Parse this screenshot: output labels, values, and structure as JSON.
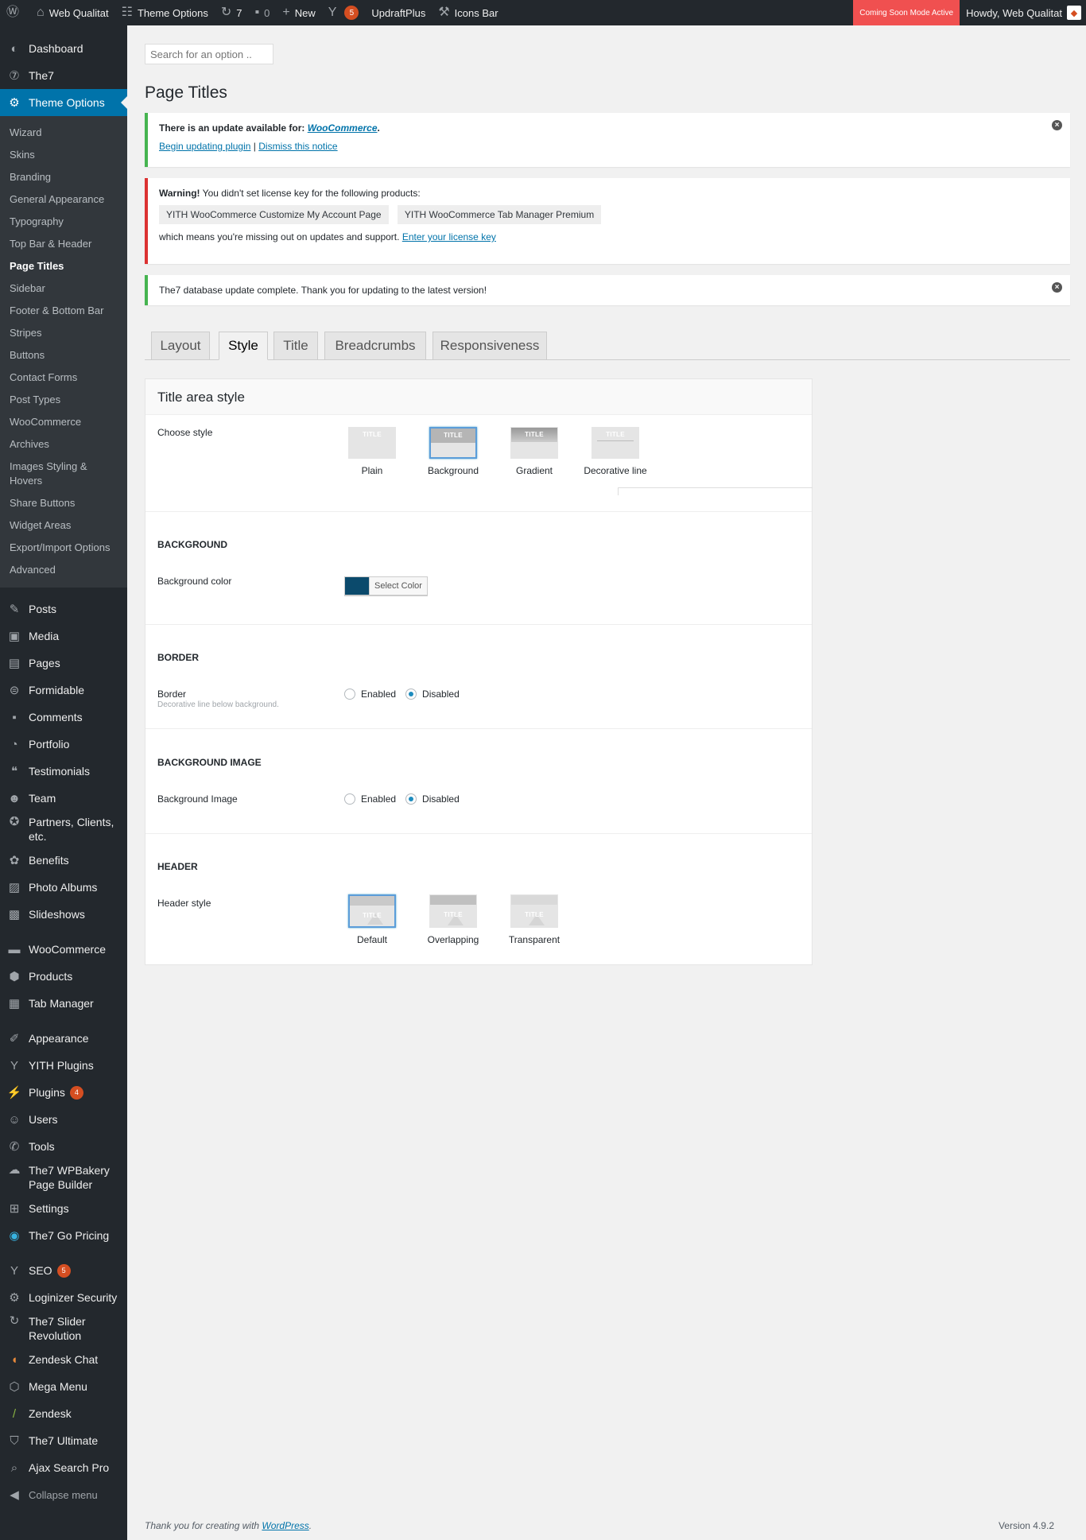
{
  "adminbar": {
    "site_name": "Web Qualitat",
    "theme_options": "Theme Options",
    "updates_count": "7",
    "comments_count": "0",
    "new_label": "New",
    "seo_badge": "5",
    "updraft": "UpdraftPlus",
    "icons_bar": "Icons Bar",
    "coming_soon": "Coming Soon Mode Active",
    "howdy": "Howdy, Web Qualitat"
  },
  "sidebar": {
    "top_items": [
      {
        "label": "Dashboard",
        "icon": "dashboard-icon"
      },
      {
        "label": "The7",
        "icon": "the7-icon"
      },
      {
        "label": "Theme Options",
        "icon": "gear-icon"
      }
    ],
    "submenu": [
      "Wizard",
      "Skins",
      "Branding",
      "General Appearance",
      "Typography",
      "Top Bar & Header",
      "Page Titles",
      "Sidebar",
      "Footer & Bottom Bar",
      "Stripes",
      "Buttons",
      "Contact Forms",
      "Post Types",
      "WooCommerce",
      "Archives",
      "Images Styling & Hovers",
      "Share Buttons",
      "Widget Areas",
      "Export/Import Options",
      "Advanced"
    ],
    "group1": [
      "Posts",
      "Media",
      "Pages",
      "Formidable",
      "Comments",
      "Portfolio",
      "Testimonials",
      "Team",
      "Partners, Clients, etc.",
      "Benefits",
      "Photo Albums",
      "Slideshows"
    ],
    "group2": [
      "WooCommerce",
      "Products",
      "Tab Manager"
    ],
    "group3": [
      "Appearance",
      "YITH Plugins",
      "Plugins",
      "Users",
      "Tools",
      "The7 WPBakery Page Builder",
      "Settings",
      "The7 Go Pricing"
    ],
    "plugins_badge": "4",
    "group4": [
      "SEO",
      "Loginizer Security",
      "The7 Slider Revolution",
      "Zendesk Chat",
      "Mega Menu",
      "Zendesk",
      "The7 Ultimate",
      "Ajax Search Pro"
    ],
    "seo_badge": "5",
    "collapse": "Collapse menu"
  },
  "search": {
    "placeholder": "Search for an option .."
  },
  "page_title": "Page Titles",
  "notices": {
    "update_text": "There is an update available for:",
    "update_link": "WooCommerce",
    "update_begin": "Begin updating plugin",
    "update_sep": "|",
    "update_dismiss": "Dismiss this notice",
    "warning_bold": "Warning!",
    "warning_text": "You didn't set license key for the following products:",
    "product1": "YITH WooCommerce Customize My Account Page",
    "product2": "YITH WooCommerce Tab Manager Premium",
    "warning_tail": "which means you're missing out on updates and support.",
    "license_link": "Enter your license key",
    "db_update": "The7 database update complete. Thank you for updating to the latest version!"
  },
  "tabs": [
    "Layout",
    "Style",
    "Title",
    "Breadcrumbs",
    "Responsiveness"
  ],
  "panel": {
    "heading": "Title area style",
    "choose_style": "Choose style",
    "styles": [
      "Plain",
      "Background",
      "Gradient",
      "Decorative line"
    ],
    "background_section": "BACKGROUND",
    "background_color": "Background color",
    "select_color": "Select Color",
    "color_value": "#0b4a6c",
    "border_section": "BORDER",
    "border_label": "Border",
    "border_desc": "Decorative line below background.",
    "bg_image_section": "BACKGROUND IMAGE",
    "bg_image_label": "Background Image",
    "enabled": "Enabled",
    "disabled": "Disabled",
    "header_section": "HEADER",
    "header_style": "Header style",
    "header_styles": [
      "Default",
      "Overlapping",
      "Transparent"
    ],
    "thumb_title": "TITLE"
  },
  "footer": {
    "thanks": "Thank you for creating with",
    "wp_link": "WordPress",
    "period": ".",
    "version": "Version 4.9.2"
  },
  "colors": {
    "accent": "#0073aa",
    "sidebar": "#23282d",
    "coming_soon": "#f05050",
    "success": "#46b450",
    "error": "#dc3232"
  }
}
